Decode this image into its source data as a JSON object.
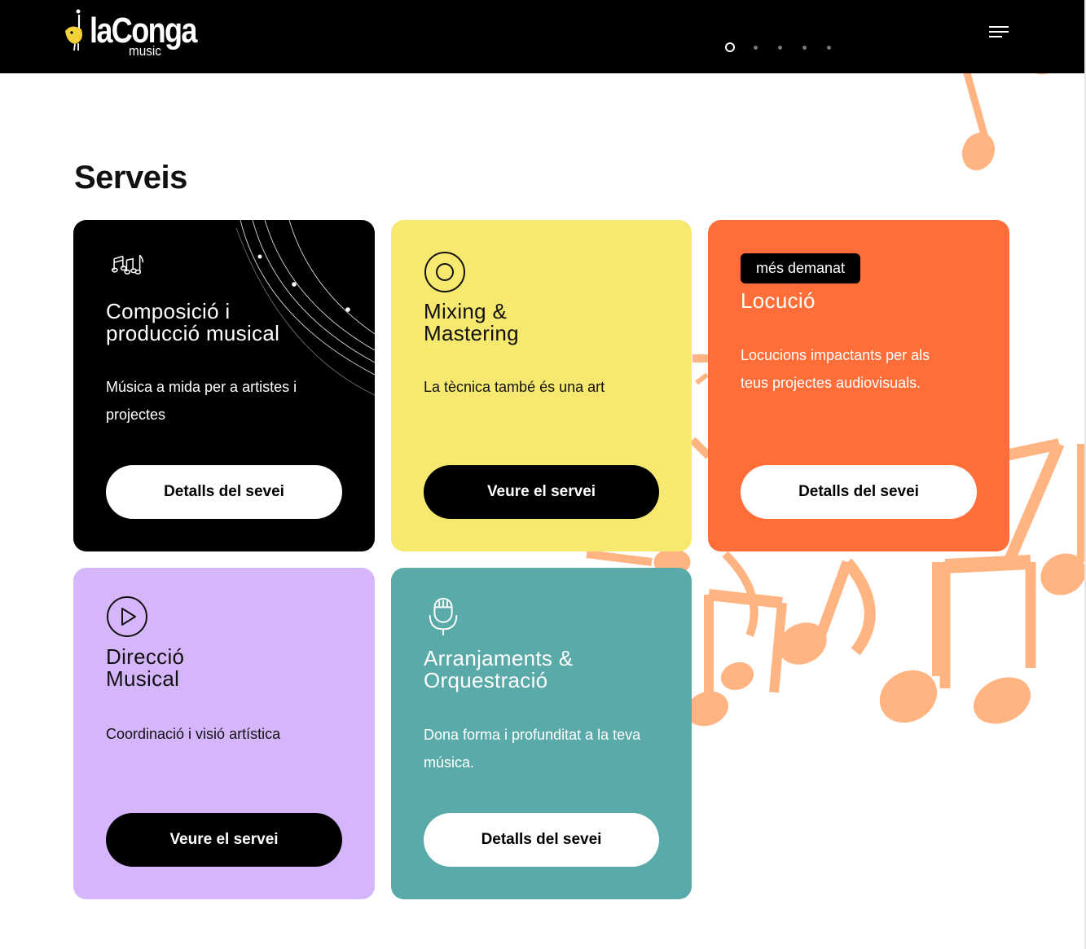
{
  "header": {
    "logo_text": "laConga",
    "logo_subtext": "music",
    "slides": 5,
    "active_slide": 1,
    "menu_icon": "hamburger-icon"
  },
  "page": {
    "title": "Serveis"
  },
  "cards": [
    {
      "icon": "music-notes-icon",
      "title_line1": "Composició i",
      "title_line2": "producció musical",
      "description": "Música a mida per a artistes i projectes",
      "button": "Detalls del sevei",
      "background": "#000000"
    },
    {
      "icon": "vinyl-disc-icon",
      "title_line1": "Mixing &",
      "title_line2": "Mastering",
      "description": "La tècnica també és una art",
      "button": "Veure el servei",
      "background": "#f7e86f"
    },
    {
      "icon": "",
      "badge": "més demanat",
      "title_line1": "Locució",
      "description": "Locucions impactants per als teus projectes audiovisuals.",
      "button": "Detalls del sevei",
      "background": "#ff6d39"
    },
    {
      "icon": "play-circle-icon",
      "title_line1": "Direcció",
      "title_line2": "Musical",
      "description": "Coordinació i visió artística",
      "button": "Veure el servei",
      "background": "#d6b6fb"
    },
    {
      "icon": "microphone-icon",
      "title_line1": "Arranjaments &",
      "title_line2": "Orquestració",
      "description": "Dona forma i profunditat a la teva música.",
      "button": "Detalls del sevei",
      "background": "#59aaa8"
    }
  ],
  "colors": {
    "note_decoration": "#ffb482",
    "header_bg": "#000000"
  }
}
